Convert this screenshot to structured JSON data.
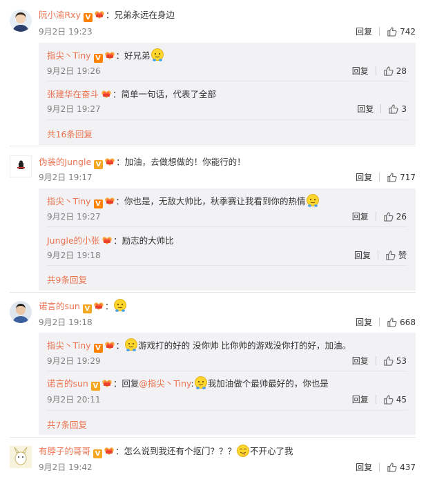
{
  "threads": [
    {
      "user": "阮小渝Rxy",
      "badge_color": "#ff8200",
      "text": "：兄弟永远在身边",
      "time": "9月2日 19:23",
      "reply_label": "回复",
      "likes": "742",
      "replies": [
        {
          "user": "指尖丶Tiny",
          "text": "：好兄弟",
          "time": "9月2日 19:26",
          "reply_label": "回复",
          "likes": "28"
        },
        {
          "user": "张建华在奋斗",
          "text": "：简单一句话，代表了全部",
          "time": "9月2日 19:27",
          "reply_label": "回复",
          "likes": "3"
        }
      ],
      "more": "共16条回复"
    },
    {
      "user": "伪装的Jungle",
      "text": "：加油，去做想做的！你能行的！",
      "time": "9月2日 19:17",
      "reply_label": "回复",
      "likes": "717",
      "replies": [
        {
          "user": "指尖丶Tiny",
          "text": "：你也是，无敌大帅比，秋季赛让我看到你的热情",
          "time": "9月2日 19:27",
          "reply_label": "回复",
          "likes": "26"
        },
        {
          "user": "Jungle的小张",
          "text": "：励志的大帅比",
          "time": "9月2日 19:18",
          "reply_label": "回复",
          "likes": "赞"
        }
      ],
      "more": "共9条回复"
    },
    {
      "user": "诺言的sun",
      "text": "：",
      "time": "9月2日 19:18",
      "reply_label": "回复",
      "likes": "668",
      "replies": [
        {
          "user": "指尖丶Tiny",
          "text": "：",
          "text2": "游戏打的好的 没你帅 比你帅的游戏没你打的好，加油。",
          "time": "9月2日 19:29",
          "reply_label": "回复",
          "likes": "53"
        },
        {
          "user": "诺言的sun",
          "text": "：回复",
          "mention": "@指尖丶Tiny",
          "text2": ":",
          "text3": "我加油做个最帅最好的，你也是",
          "time": "9月2日 20:11",
          "reply_label": "回复",
          "likes": "45"
        }
      ],
      "more": "共7条回复"
    },
    {
      "user": "有脖子的哥哥",
      "text": "：怎么说到我还有个抠门？？？",
      "text2": "不开心了我",
      "time": "9月2日 19:42",
      "reply_label": "回复",
      "likes": "437"
    }
  ],
  "icons": {
    "verified": "verified-v-badge",
    "fan": "fan-club-badge",
    "like": "thumbs-up-icon",
    "emoji_smile": "smile-emoji",
    "emoji_sad": "tongue-emoji"
  },
  "badge_v_label": "V",
  "colors": {
    "accent": "#eb7350",
    "reply_bg": "#f2f2f5"
  }
}
